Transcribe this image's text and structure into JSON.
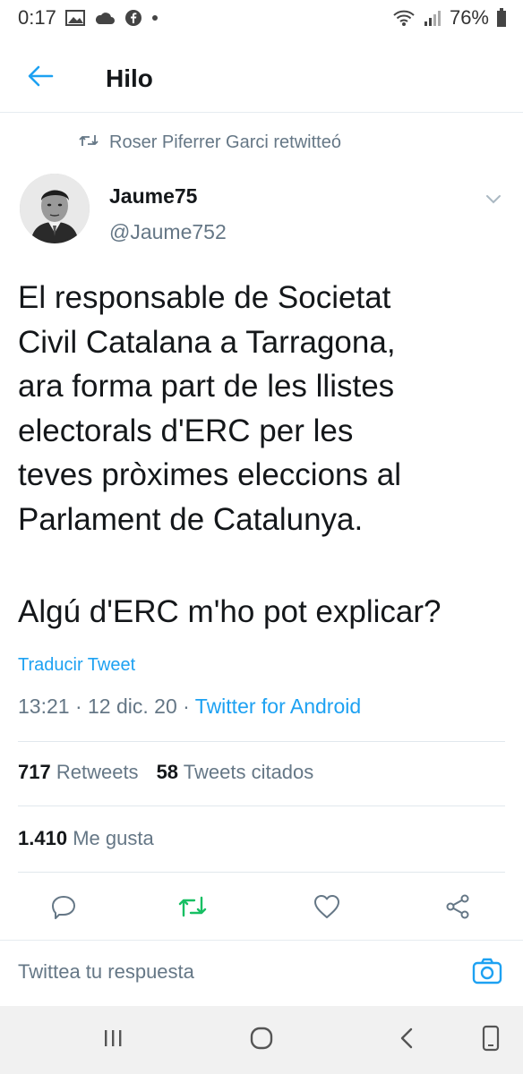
{
  "status_bar": {
    "time": "0:17",
    "battery": "76%"
  },
  "header": {
    "title": "Hilo"
  },
  "retweet_context": {
    "text": "Roser Piferrer Garci retwitteó"
  },
  "author": {
    "name": "Jaume75",
    "handle": "@Jaume752"
  },
  "tweet": {
    "lines": [
      "El responsable de Societat",
      "Civil Catalana a Tarragona,",
      "ara forma part de les llistes",
      "electorals d'ERC per les",
      "teves pròximes eleccions al",
      "Parlament de Catalunya."
    ],
    "question": "Algú d'ERC m'ho pot explicar?",
    "translate_label": "Traducir Tweet",
    "time": "13:21",
    "date": "12 dic. 20",
    "source": "Twitter for Android",
    "separator": " · "
  },
  "stats": {
    "retweets_count": "717",
    "retweets_label": "Retweets",
    "quotes_count": "58",
    "quotes_label": "Tweets citados",
    "likes_count": "1.410",
    "likes_label": "Me gusta"
  },
  "reply": {
    "placeholder": "Twittea tu respuesta"
  },
  "colors": {
    "accent": "#1da1f2",
    "retweet_green": "#17bf63",
    "secondary_text": "#657786",
    "primary_text": "#14171a"
  },
  "icons": {
    "back": "arrow-left-icon",
    "retweet_context": "retweet-icon",
    "menu": "chevron-down-icon",
    "reply": "reply-icon",
    "retweet": "retweet-icon",
    "like": "heart-icon",
    "share": "share-icon",
    "camera": "camera-icon"
  }
}
